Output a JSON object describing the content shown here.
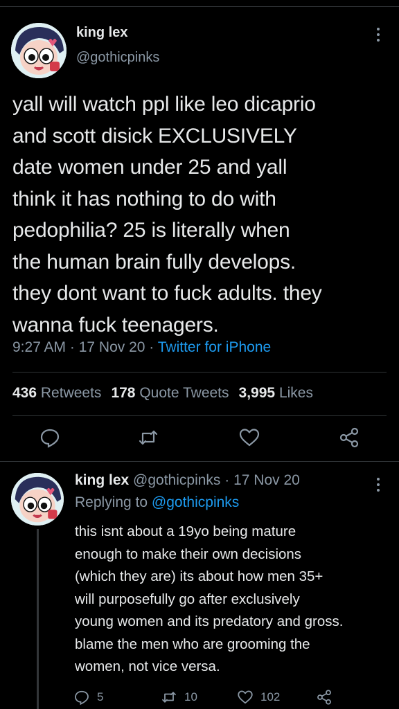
{
  "tweet": {
    "author_name": "king lex",
    "author_handle": "@gothicpinks",
    "text": "yall will watch ppl like leo dicaprio\nand scott disick EXCLUSIVELY\ndate women under 25 and yall\nthink it has nothing to do with\npedophilia? 25 is literally when\nthe human brain fully develops.\nthey dont want to fuck adults. they\nwanna fuck teenagers.",
    "time": "9:27 AM",
    "date": "17 Nov 20",
    "separator": " · ",
    "source": "Twitter for iPhone",
    "retweets_count": "436",
    "retweets_label": "Retweets",
    "quotes_count": "178",
    "quotes_label": "Quote Tweets",
    "likes_count": "3,995",
    "likes_label": "Likes",
    "icons": [
      "reply-icon",
      "retweet-icon",
      "like-icon",
      "share-icon"
    ]
  },
  "reply": {
    "author_name": "king lex",
    "author_handle": "@gothicpinks",
    "separator": " · ",
    "date": "17 Nov 20",
    "replying_label": "Replying to ",
    "replying_to": "@gothicpinks",
    "text": "this isnt about a 19yo being mature\nenough to make their own decisions\n(which they are) its about how men 35+\nwill purposefully go after exclusively\nyoung women and its predatory and gross.\nblame the men who are grooming the\nwomen, not vice versa.",
    "reply_count": "5",
    "retweet_count": "10",
    "like_count": "102"
  },
  "colors": {
    "background": "#000000",
    "text": "#e7e9ea",
    "secondary": "#8b98a5",
    "accent": "#1d9bf0",
    "divider": "#2f3336"
  }
}
